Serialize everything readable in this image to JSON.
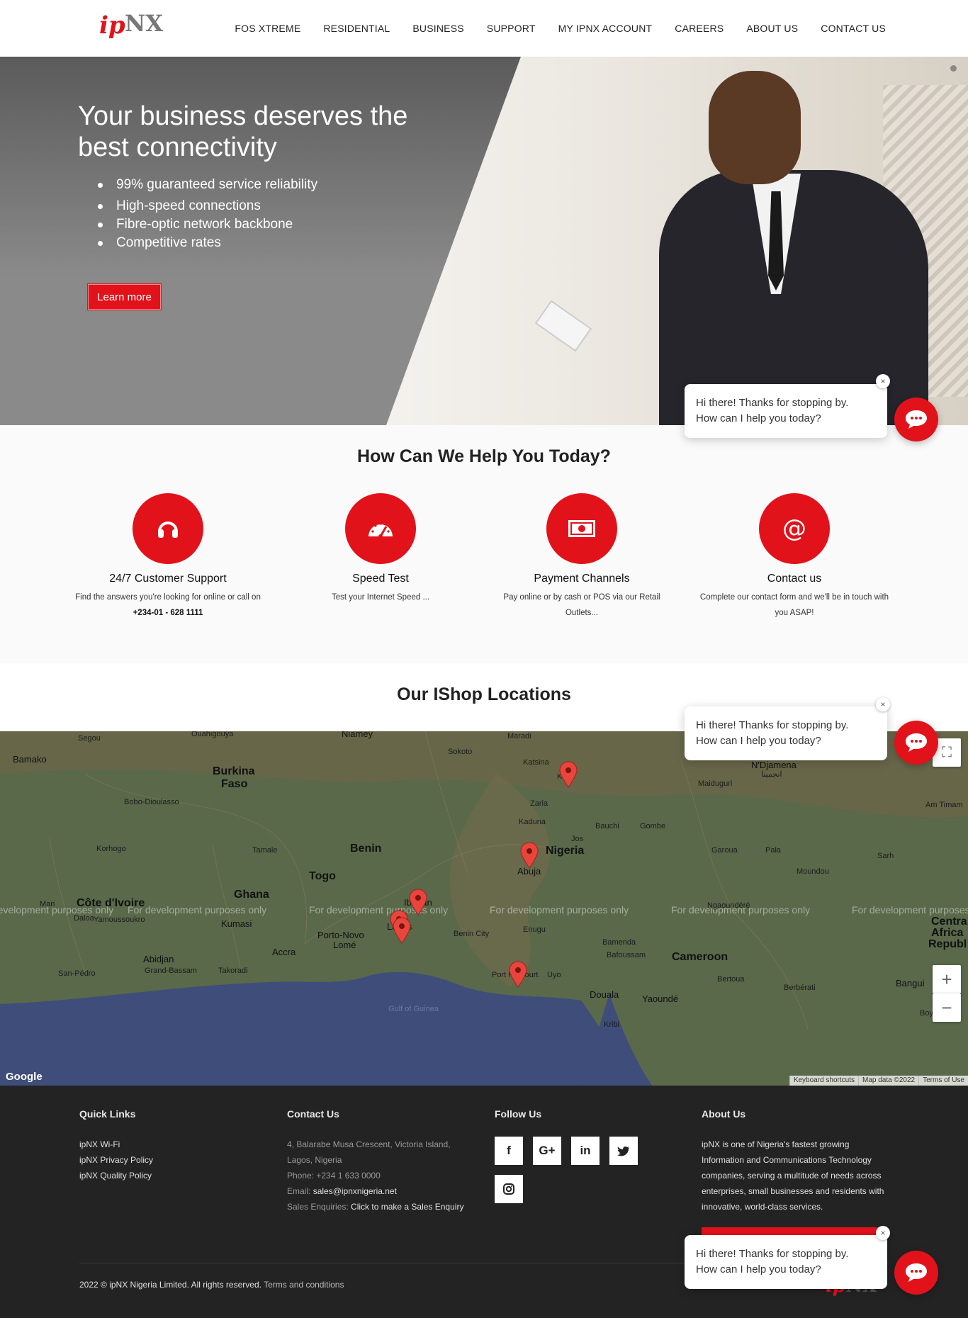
{
  "header": {
    "logo_text_red": "ip",
    "logo_text_grey": "NX",
    "nav": [
      "FOS XTREME",
      "RESIDENTIAL",
      "BUSINESS",
      "SUPPORT",
      "MY IPNX ACCOUNT",
      "CAREERS",
      "ABOUT US",
      "CONTACT US"
    ]
  },
  "hero": {
    "title": "Your business deserves the best connectivity",
    "bullets": [
      "99% guaranteed service reliability",
      "High-speed connections",
      "Fibre-optic network backbone",
      "Competitive rates"
    ],
    "button": "Learn more"
  },
  "help": {
    "title": "How Can We Help You Today?",
    "cards": [
      {
        "icon": "headphones-icon",
        "title": "24/7 Customer Support",
        "text": "Find the answers you're looking for online or call on ",
        "phone": "+234-01 - 628 1111"
      },
      {
        "icon": "speedometer-icon",
        "title": "Speed Test",
        "text": "Test your Internet Speed ..."
      },
      {
        "icon": "money-icon",
        "title": "Payment Channels",
        "text": "Pay online or by cash or POS via our Retail Outlets..."
      },
      {
        "icon": "at-icon",
        "title": "Contact us",
        "text": "Complete our contact form and we'll be in touch with you ASAP!"
      }
    ]
  },
  "locations": {
    "title": "Our IShop Locations",
    "watermark": "For development purposes only",
    "places": {
      "bamako": "Bamako",
      "segou": "Segou",
      "burkina": "Burkina",
      "faso": "Faso",
      "bobo": "Bobo-Dioulasso",
      "korhogo": "Korhogo",
      "tamale": "Tamale",
      "benin": "Benin",
      "togo": "Togo",
      "ghana": "Ghana",
      "cote": "Côte d'Ivoire",
      "man": "Man",
      "daloa": "Daloa",
      "yamoussoukro": "Yamoussoukro",
      "kumasi": "Kumasi",
      "abidjan": "Abidjan",
      "grandbassam": "Grand-Bassam",
      "sanpedro": "San-Pédro",
      "takoradi": "Takoradi",
      "accra": "Accra",
      "portonovo": "Porto-Novo",
      "lome": "Lomé",
      "niamey": "Niamey",
      "sokoto": "Sokoto",
      "maradi": "Maradi",
      "katsina": "Katsina",
      "kano": "Kano",
      "zaria": "Zaria",
      "kaduna": "Kaduna",
      "bauchi": "Bauchi",
      "gombe": "Gombe",
      "jos": "Jos",
      "nigeria": "Nigeria",
      "abuja": "Abuja",
      "ibadan": "Ibadan",
      "lagos": "Lagos",
      "benincity": "Benin City",
      "enugu": "Enugu",
      "porth": "Port Harcourt",
      "uyo": "Uyo",
      "bamenda": "Bamenda",
      "bafoussam": "Bafoussam",
      "cameroon": "Cameroon",
      "douala": "Douala",
      "yaounde": "Yaoundé",
      "kribi": "Kribi",
      "bertoua": "Bertoua",
      "berberati": "Berbérati",
      "bangui": "Bangui",
      "ndjamena": "N'Djamena",
      "ndjamena_ar": "انجمينا",
      "maiduguri": "Maiduguri",
      "amtiman": "Am Timam",
      "garoua": "Garoua",
      "pala": "Pala",
      "mondou": "Moundou",
      "sarh": "Sarh",
      "ngaoundere": "Ngaoundéré",
      "car1": "Centra",
      "car2": "Africa",
      "car3": "Republ",
      "gulf": "Gulf of Guinea",
      "ouahigouya": "Ouahigouya",
      "boy": "Boy"
    },
    "map_footer": [
      "Keyboard shortcuts",
      "Map data ©2022",
      "Terms of Use"
    ],
    "google": "Google"
  },
  "footer": {
    "quick_links": {
      "title": "Quick Links",
      "items": [
        "ipNX Wi-Fi",
        "ipNX Privacy Policy",
        "ipNX Quality Policy"
      ]
    },
    "contact": {
      "title": "Contact Us",
      "address1": "4, Balarabe Musa Crescent, Victoria Island,",
      "address2": "Lagos, Nigeria",
      "phone": "Phone: +234 1 633 0000",
      "email_label": "Email: ",
      "email": "sales@ipnxnigeria.net",
      "sales_label": "Sales Enquiries: ",
      "sales_link": "Click to make a Sales Enquiry"
    },
    "follow": {
      "title": "Follow Us",
      "icons": [
        "facebook-icon",
        "google-plus-icon",
        "linkedin-icon",
        "twitter-icon",
        "instagram-icon"
      ]
    },
    "about": {
      "title": "About Us",
      "text": "ipNX is one of Nigeria's fastest growing Information and Communications Technology companies, serving a multitude of needs across enterprises, small businesses and residents with innovative, world-class services."
    },
    "copyright": "2022 © ipNX Nigeria Limited. All rights reserved.",
    "terms": "Terms and conditions"
  },
  "chat": {
    "line1": "Hi there! Thanks for stopping by.",
    "line2": "How can I help you today?",
    "close": "×"
  },
  "colors": {
    "brand_red": "#e2121b",
    "footer_bg": "#232323"
  }
}
